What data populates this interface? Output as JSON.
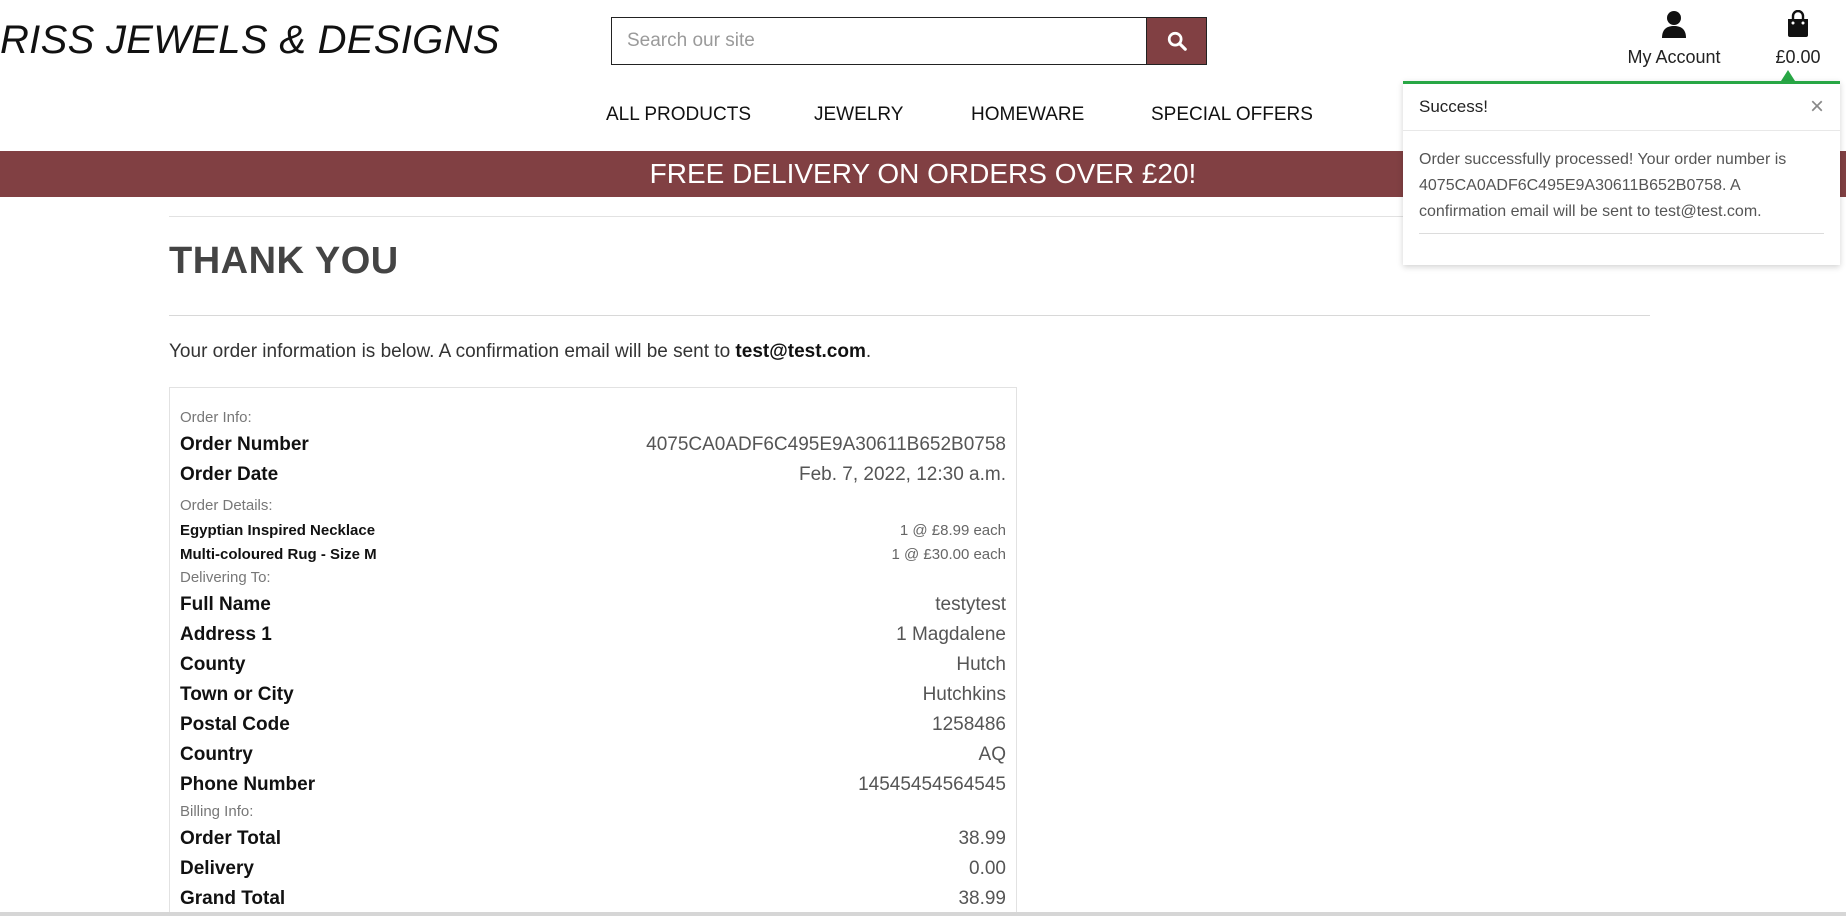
{
  "header": {
    "brand": "RISS JEWELS & DESIGNS",
    "search_placeholder": "Search our site",
    "account_label": "My Account",
    "bag_total": "£0.00"
  },
  "nav": {
    "items": [
      "ALL PRODUCTS",
      "JEWELRY",
      "HOMEWARE",
      "SPECIAL OFFERS"
    ]
  },
  "banner": {
    "text": "FREE DELIVERY ON ORDERS OVER £20!"
  },
  "main": {
    "title": "THANK YOU",
    "intro_prefix": "Your order information is below. A confirmation email will be sent to ",
    "intro_email": "test@test.com",
    "intro_suffix": "."
  },
  "order": {
    "order_info_label": "Order Info:",
    "order_number_key": "Order Number",
    "order_number": "4075CA0ADF6C495E9A30611B652B0758",
    "order_date_key": "Order Date",
    "order_date": "Feb. 7, 2022, 12:30 a.m.",
    "details_label": "Order Details:",
    "items": [
      {
        "name": "Egyptian Inspired Necklace",
        "qty": "1 @ £8.99 each"
      },
      {
        "name": "Multi-coloured Rug - Size M",
        "qty": "1 @ £30.00 each"
      }
    ],
    "delivering_label": "Delivering To:",
    "delivery": [
      {
        "k": "Full Name",
        "v": "testytest"
      },
      {
        "k": "Address 1",
        "v": "1 Magdalene"
      },
      {
        "k": "County",
        "v": "Hutch"
      },
      {
        "k": "Town or City",
        "v": "Hutchkins"
      },
      {
        "k": "Postal Code",
        "v": "1258486"
      },
      {
        "k": "Country",
        "v": "AQ"
      },
      {
        "k": "Phone Number",
        "v": "14545454564545"
      }
    ],
    "billing_label": "Billing Info:",
    "billing": [
      {
        "k": "Order Total",
        "v": "38.99"
      },
      {
        "k": "Delivery",
        "v": "0.00"
      },
      {
        "k": "Grand Total",
        "v": "38.99"
      }
    ]
  },
  "toast": {
    "title": "Success!",
    "close": "×",
    "message": "Order successfully processed! Your order number is 4075CA0ADF6C495E9A30611B652B0758. A confirmation email will be sent to test@test.com.",
    "accent_color": "#28a745"
  },
  "colors": {
    "brand": "#814043"
  },
  "icons": {
    "search": "search-icon",
    "account": "user-icon",
    "bag": "shopping-bag-icon",
    "close": "close-icon"
  }
}
